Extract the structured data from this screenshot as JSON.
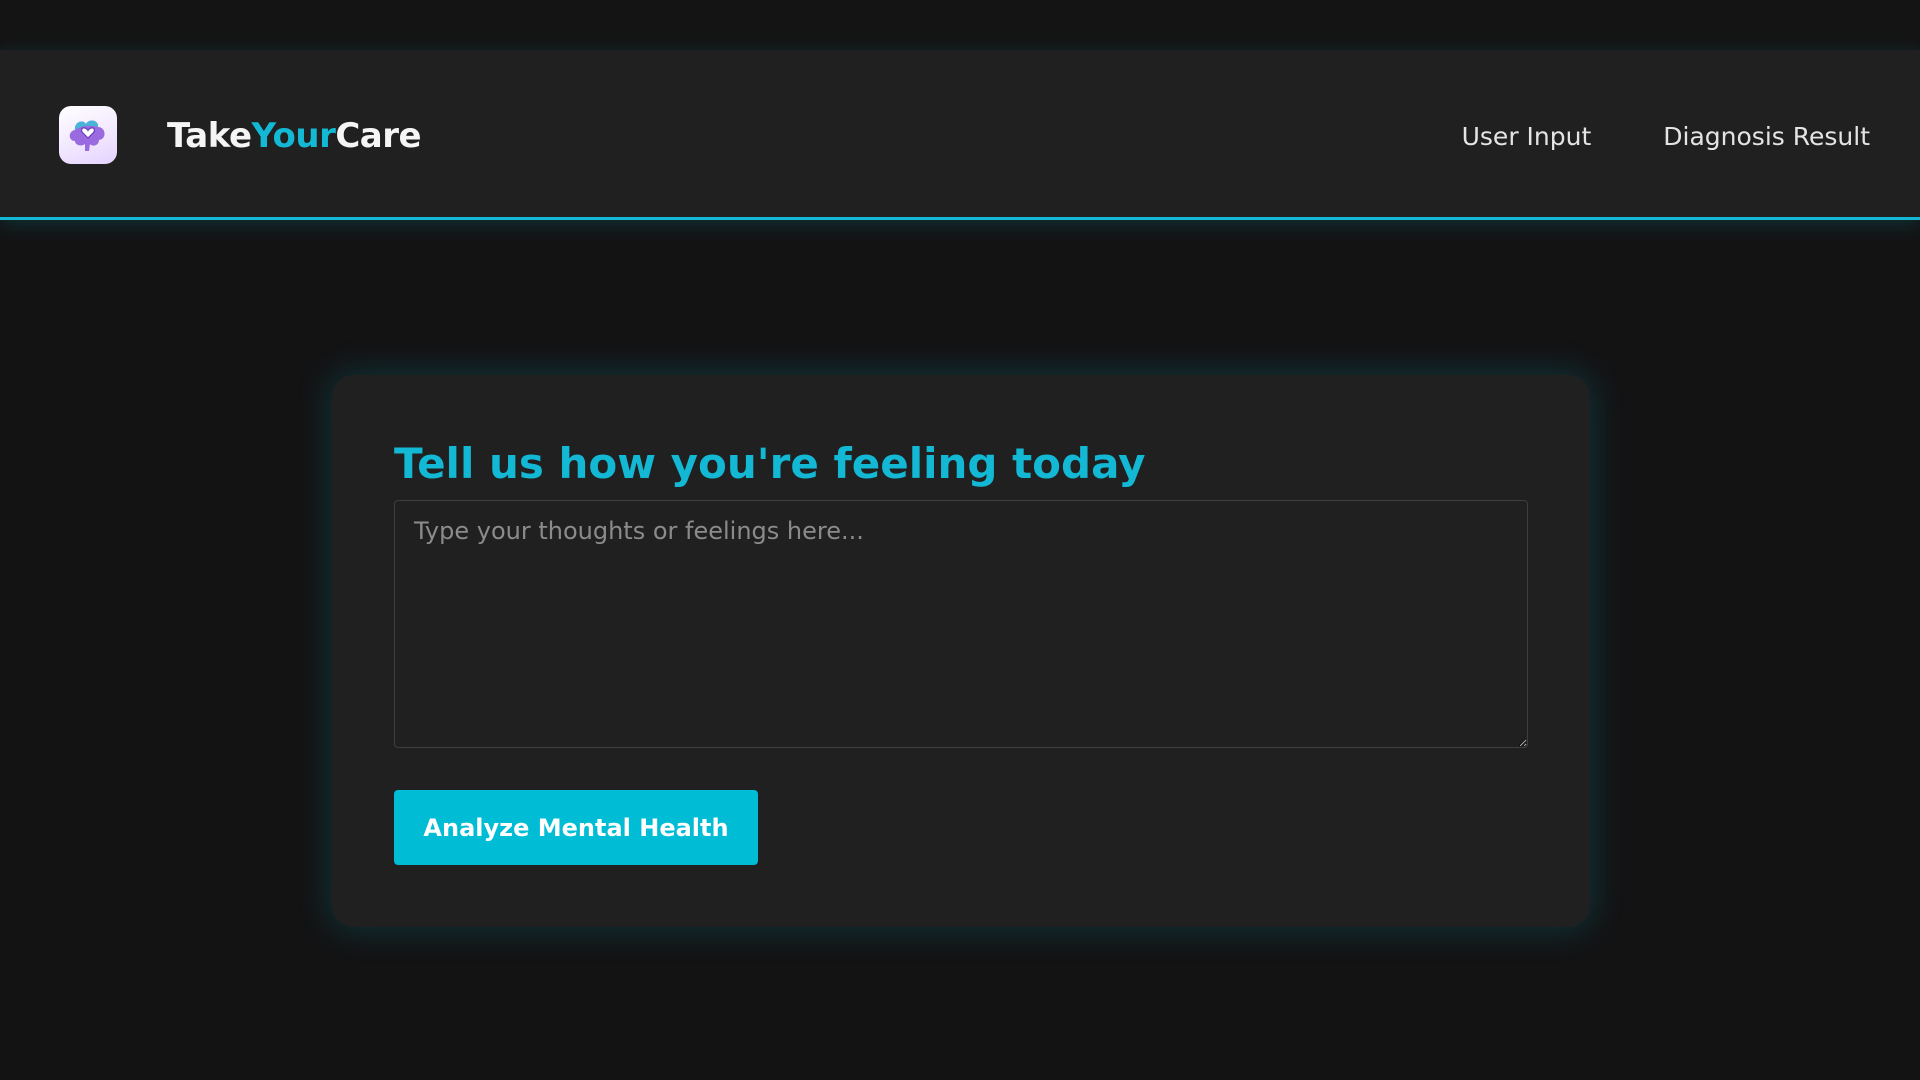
{
  "header": {
    "logo_icon": "brain-heart-icon",
    "brand_part1": "Take",
    "brand_part2": "Your",
    "brand_part3": "Care",
    "nav": [
      {
        "label": "User Input"
      },
      {
        "label": "Diagnosis Result"
      }
    ]
  },
  "main": {
    "title": "Tell us how you're feeling today",
    "textarea": {
      "value": "",
      "placeholder": "Type your thoughts or feelings here..."
    },
    "button_label": "Analyze Mental Health"
  },
  "colors": {
    "accent": "#00bcd4",
    "background": "#131314",
    "surface": "#202020"
  }
}
